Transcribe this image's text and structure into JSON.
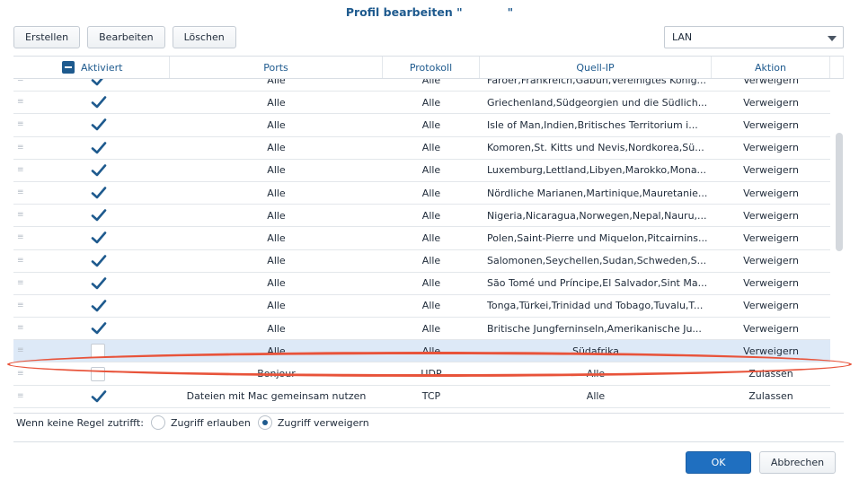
{
  "dialog": {
    "title": "Profil bearbeiten \"",
    "title_end": "\""
  },
  "toolbar": {
    "create_label": "Erstellen",
    "edit_label": "Bearbeiten",
    "delete_label": "Löschen"
  },
  "interface_select": {
    "value": "LAN"
  },
  "table": {
    "headers": [
      "Aktiviert",
      "Ports",
      "Protokoll",
      "Quell-IP",
      "Aktion"
    ],
    "rows": [
      {
        "enabled": true,
        "ports": "Alle",
        "protocol": "Alle",
        "source": "Färöer,Frankreich,Gabun,Vereinigtes König...",
        "action": "Verweigern"
      },
      {
        "enabled": true,
        "ports": "Alle",
        "protocol": "Alle",
        "source": "Griechenland,Südgeorgien und die Südlich...",
        "action": "Verweigern"
      },
      {
        "enabled": true,
        "ports": "Alle",
        "protocol": "Alle",
        "source": "Isle of Man,Indien,Britisches Territorium i...",
        "action": "Verweigern"
      },
      {
        "enabled": true,
        "ports": "Alle",
        "protocol": "Alle",
        "source": "Komoren,St. Kitts und Nevis,Nordkorea,Sü...",
        "action": "Verweigern"
      },
      {
        "enabled": true,
        "ports": "Alle",
        "protocol": "Alle",
        "source": "Luxemburg,Lettland,Libyen,Marokko,Mona...",
        "action": "Verweigern"
      },
      {
        "enabled": true,
        "ports": "Alle",
        "protocol": "Alle",
        "source": "Nördliche Marianen,Martinique,Mauretanie...",
        "action": "Verweigern"
      },
      {
        "enabled": true,
        "ports": "Alle",
        "protocol": "Alle",
        "source": "Nigeria,Nicaragua,Norwegen,Nepal,Nauru,...",
        "action": "Verweigern"
      },
      {
        "enabled": true,
        "ports": "Alle",
        "protocol": "Alle",
        "source": "Polen,Saint-Pierre und Miquelon,Pitcairnins...",
        "action": "Verweigern"
      },
      {
        "enabled": true,
        "ports": "Alle",
        "protocol": "Alle",
        "source": "Salomonen,Seychellen,Sudan,Schweden,S...",
        "action": "Verweigern"
      },
      {
        "enabled": true,
        "ports": "Alle",
        "protocol": "Alle",
        "source": "São Tomé und Príncipe,El Salvador,Sint Ma...",
        "action": "Verweigern"
      },
      {
        "enabled": true,
        "ports": "Alle",
        "protocol": "Alle",
        "source": "Tonga,Türkei,Trinidad und Tobago,Tuvalu,T...",
        "action": "Verweigern"
      },
      {
        "enabled": true,
        "ports": "Alle",
        "protocol": "Alle",
        "source": "Britische Jungferninseln,Amerikanische Ju...",
        "action": "Verweigern"
      },
      {
        "enabled": false,
        "ports": "Alle",
        "protocol": "Alle",
        "source": "Südafrika",
        "action": "Verweigern",
        "selected": true,
        "center_source": true
      },
      {
        "enabled": false,
        "ports": "Bonjour",
        "protocol": "UDP",
        "source": "Alle",
        "action": "Zulassen",
        "center_source": true
      },
      {
        "enabled": true,
        "ports": "Dateien mit Mac gemeinsam nutzen",
        "protocol": "TCP",
        "source": "Alle",
        "action": "Zulassen",
        "center_source": true
      }
    ]
  },
  "default_rule": {
    "label": "Wenn keine Regel zutrifft:",
    "allow_label": "Zugriff erlauben",
    "deny_label": "Zugriff verweigern",
    "selected": "deny"
  },
  "buttons": {
    "ok_label": "OK",
    "cancel_label": "Abbrechen"
  },
  "colors": {
    "accent": "#1e5a8e",
    "primary_button": "#1f6fc0",
    "selected_row": "#dde9f7",
    "annotation": "#e8533a"
  }
}
